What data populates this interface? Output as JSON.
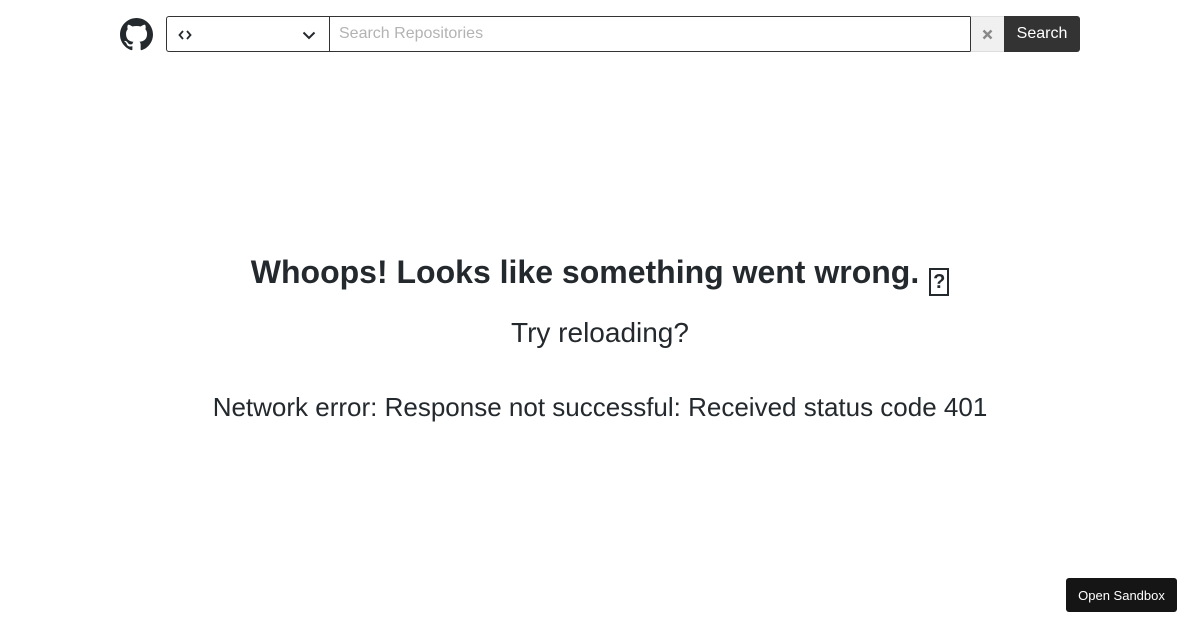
{
  "header": {
    "logo_icon": "github-mark-icon",
    "type_select": {
      "icon": "code-icon",
      "chevron_icon": "chevron-down-icon"
    },
    "search": {
      "value": "",
      "placeholder": "Search Repositories"
    },
    "clear_icon": "close-icon",
    "search_label": "Search"
  },
  "error": {
    "title": "Whoops! Looks like something went wrong.",
    "title_glyph": "?",
    "reload_text": "Try reloading?",
    "detail": "Network error: Response not successful: Received status code 401"
  },
  "sandbox_button_label": "Open Sandbox",
  "colors": {
    "text": "#24292e",
    "button_dark": "#333333",
    "sandbox_button": "#151515",
    "placeholder": "#b3b3b3"
  }
}
